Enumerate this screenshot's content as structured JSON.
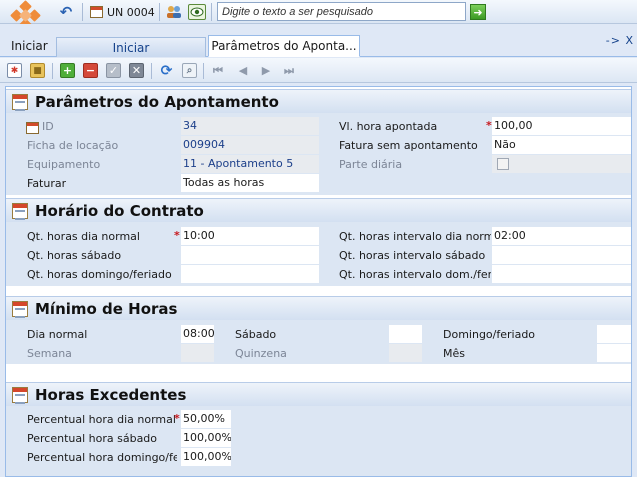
{
  "topbar": {
    "unit_label": "UN 0004",
    "search_placeholder": "Digite o texto a ser pesquisado"
  },
  "tabs": {
    "home_label": "Iniciar",
    "tab_home": "Iniciar",
    "tab_active": "Parâmetros do Aponta...",
    "tab_tools": "-> X"
  },
  "sections": {
    "parametros": {
      "title": "Parâmetros do Apontamento",
      "id_label": "ID",
      "id_value": "34",
      "ficha_label": "Ficha de locação",
      "ficha_value": "009904",
      "equip_label": "Equipamento",
      "equip_value": "11 - Apontamento 5",
      "faturar_label": "Faturar",
      "faturar_value": "Todas as horas",
      "vl_hora_label": "Vl. hora apontada",
      "vl_hora_value": "100,00",
      "fatura_sem_label": "Fatura sem apontamento",
      "fatura_sem_value": "Não",
      "parte_label": "Parte diária"
    },
    "horario": {
      "title": "Horário do Contrato",
      "dia_normal_label": "Qt. horas dia normal",
      "dia_normal_value": "10:00",
      "sabado_label": "Qt. horas sábado",
      "domingo_label": "Qt. horas domingo/feriado",
      "int_dia_label": "Qt. horas intervalo dia normal",
      "int_dia_value": "02:00",
      "int_sabado_label": "Qt. horas intervalo sábado",
      "int_dom_label": "Qt. horas intervalo dom./feriad"
    },
    "minimo": {
      "title": "Mínimo de Horas",
      "dia_normal_label": "Dia normal",
      "dia_normal_value": "08:00",
      "sabado_label": "Sábado",
      "domingo_label": "Domingo/feriado",
      "semana_label": "Semana",
      "quinzena_label": "Quinzena",
      "mes_label": "Mês"
    },
    "excedentes": {
      "title": "Horas Excedentes",
      "perc_dia_label": "Percentual hora dia normal",
      "perc_dia_value": "50,00%",
      "perc_sab_label": "Percentual hora sábado",
      "perc_sab_value": "100,00%",
      "perc_dom_label": "Percentual hora domingo/feriac",
      "perc_dom_value": "100,00%"
    }
  },
  "required_mark": "*",
  "icons": [
    "logo-icon",
    "undo-icon",
    "calendar-icon",
    "people-icon",
    "eye-icon",
    "go-icon",
    "new-record-icon",
    "lock-icon",
    "add-icon",
    "delete-icon",
    "confirm-icon",
    "cancel-icon",
    "refresh-icon",
    "find-icon",
    "first-icon",
    "prev-icon",
    "next-icon",
    "last-icon",
    "section-table-icon"
  ]
}
